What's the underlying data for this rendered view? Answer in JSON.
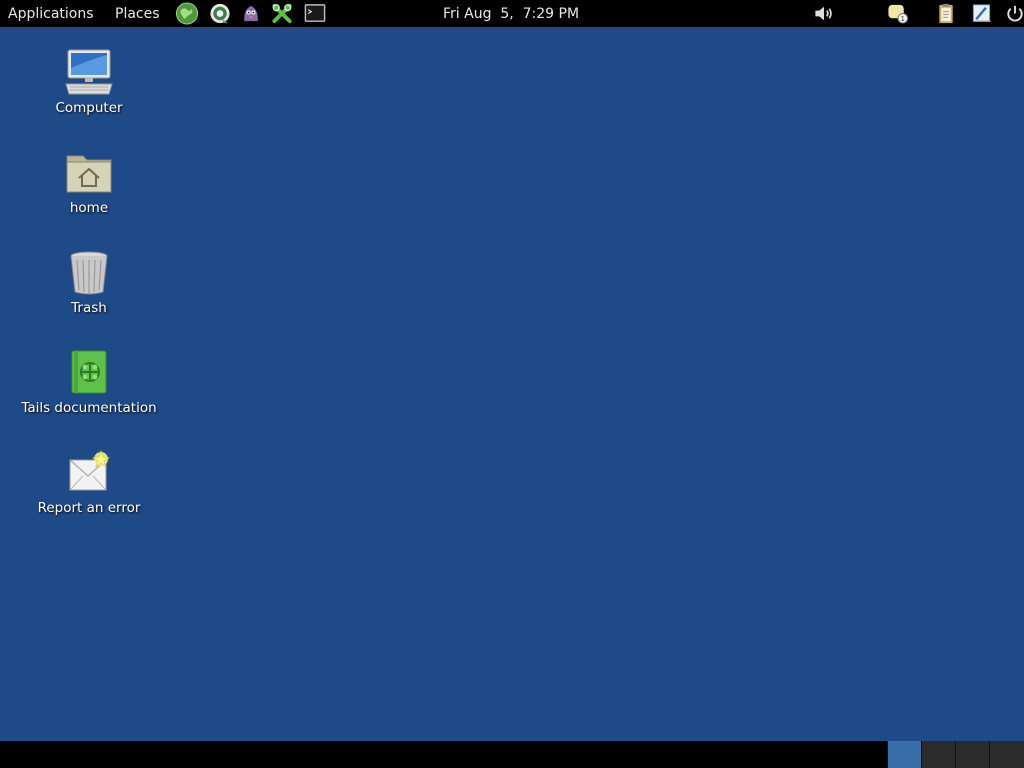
{
  "top_panel": {
    "applications_label": "Applications",
    "places_label": "Places",
    "clock": "Fri Aug  5,  7:29 PM",
    "launchers": [
      "globe-icon",
      "tor-onion-icon",
      "pidgin-icon",
      "keepassx-icon",
      "terminal-icon"
    ],
    "tray": [
      "volume-icon",
      "notification-icon",
      "clipboard-icon",
      "accessibility-icon",
      "power-icon"
    ]
  },
  "desktop": {
    "items": [
      {
        "label": "Computer",
        "icon": "computer-icon"
      },
      {
        "label": "home",
        "icon": "home-folder-icon"
      },
      {
        "label": "Trash",
        "icon": "trash-icon"
      },
      {
        "label": "Tails documentation",
        "icon": "tails-doc-icon"
      },
      {
        "label": "Report an error",
        "icon": "report-error-icon"
      }
    ]
  },
  "bottom_panel": {
    "workspaces": 4,
    "active_workspace": 1
  },
  "colors": {
    "desktop_bg": "#1f4a88",
    "panel_bg": "#000000",
    "active_workspace": "#3a6ea8"
  }
}
